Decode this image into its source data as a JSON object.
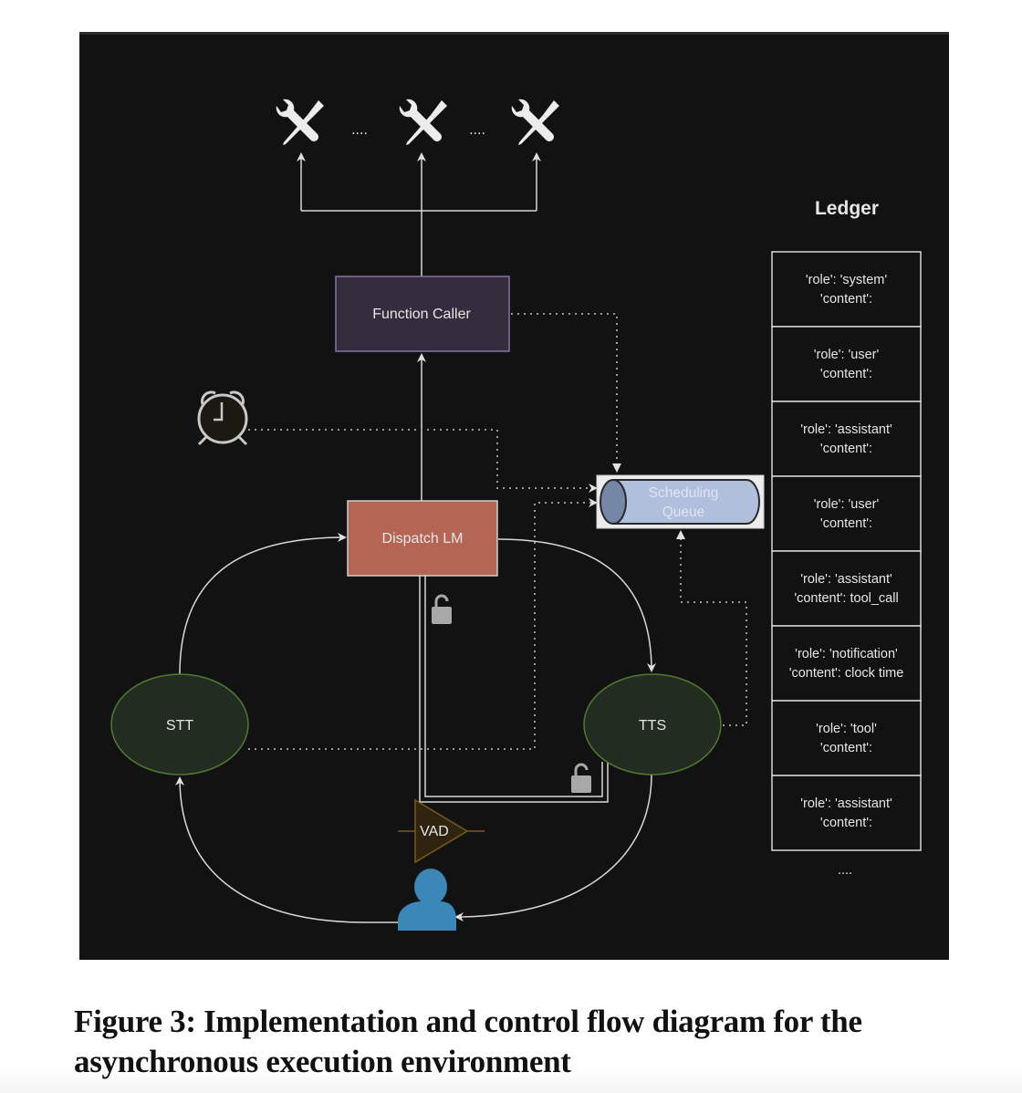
{
  "diagram": {
    "tools": {
      "icon": "tools-icon",
      "count_shown": 3,
      "ellipsis": "...."
    },
    "nodes": {
      "function_caller": "Function Caller",
      "dispatch_lm": "Dispatch LM",
      "scheduling_queue_line1": "Scheduling",
      "scheduling_queue_line2": "Queue",
      "stt": "STT",
      "tts": "TTS",
      "vad": "VAD"
    },
    "icons": {
      "clock": "alarm-clock-icon",
      "lock": "unlocked-padlock-icon",
      "user": "user-icon"
    },
    "colors": {
      "background": "#121212",
      "function_caller_fill": "#352d3e",
      "function_caller_stroke": "#8a6fa3",
      "dispatch_fill": "#b56554",
      "dispatch_stroke": "#d0d0d0",
      "ellipse_fill": "#222c20",
      "ellipse_stroke": "#4f7a32",
      "queue_fill": "#b0bfdc",
      "queue_end": "#7487a6",
      "vad_fill": "#2e2410",
      "vad_stroke": "#7a5a1a",
      "user": "#3a87b8",
      "lock": "#a8a8a8",
      "edge": "#d8d8d8"
    },
    "ledger": {
      "title": "Ledger",
      "entries": [
        {
          "line1": "'role': 'system'",
          "line2": "'content':"
        },
        {
          "line1": "'role': 'user'",
          "line2": "'content':"
        },
        {
          "line1": "'role': 'assistant'",
          "line2": "'content':"
        },
        {
          "line1": "'role': 'user'",
          "line2": "'content':"
        },
        {
          "line1": "'role': 'assistant'",
          "line2": "'content': tool_call"
        },
        {
          "line1": "'role': 'notification'",
          "line2": "'content': clock time"
        },
        {
          "line1": "'role': 'tool'",
          "line2": "'content':"
        },
        {
          "line1": "'role': 'assistant'",
          "line2": "'content':"
        }
      ],
      "ellipsis": "...."
    }
  },
  "caption": "Figure 3: Implementation and control flow diagram for the asynchronous execution environment"
}
